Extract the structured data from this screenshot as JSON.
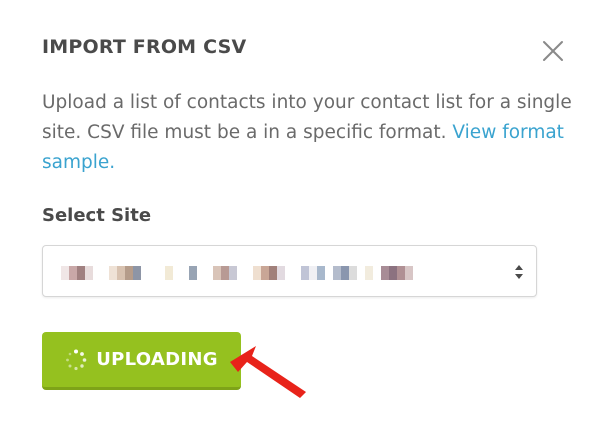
{
  "modal": {
    "title": "IMPORT FROM CSV",
    "description": "Upload a list of contacts into your contact list for a single site. CSV file must be a in a specific format.",
    "link_text": "View format sample.",
    "select_label": "Select Site",
    "upload_button_label": "UPLOADING"
  },
  "icons": {
    "close": "close-icon",
    "spinner": "spinner-icon",
    "select_arrows": "sort-arrows-icon",
    "annotation": "red-pointer-arrow-icon"
  },
  "colors": {
    "button": "#95c11f",
    "link": "#3aa3cf",
    "annotation": "#e8231a",
    "title": "#4a4a4a"
  }
}
